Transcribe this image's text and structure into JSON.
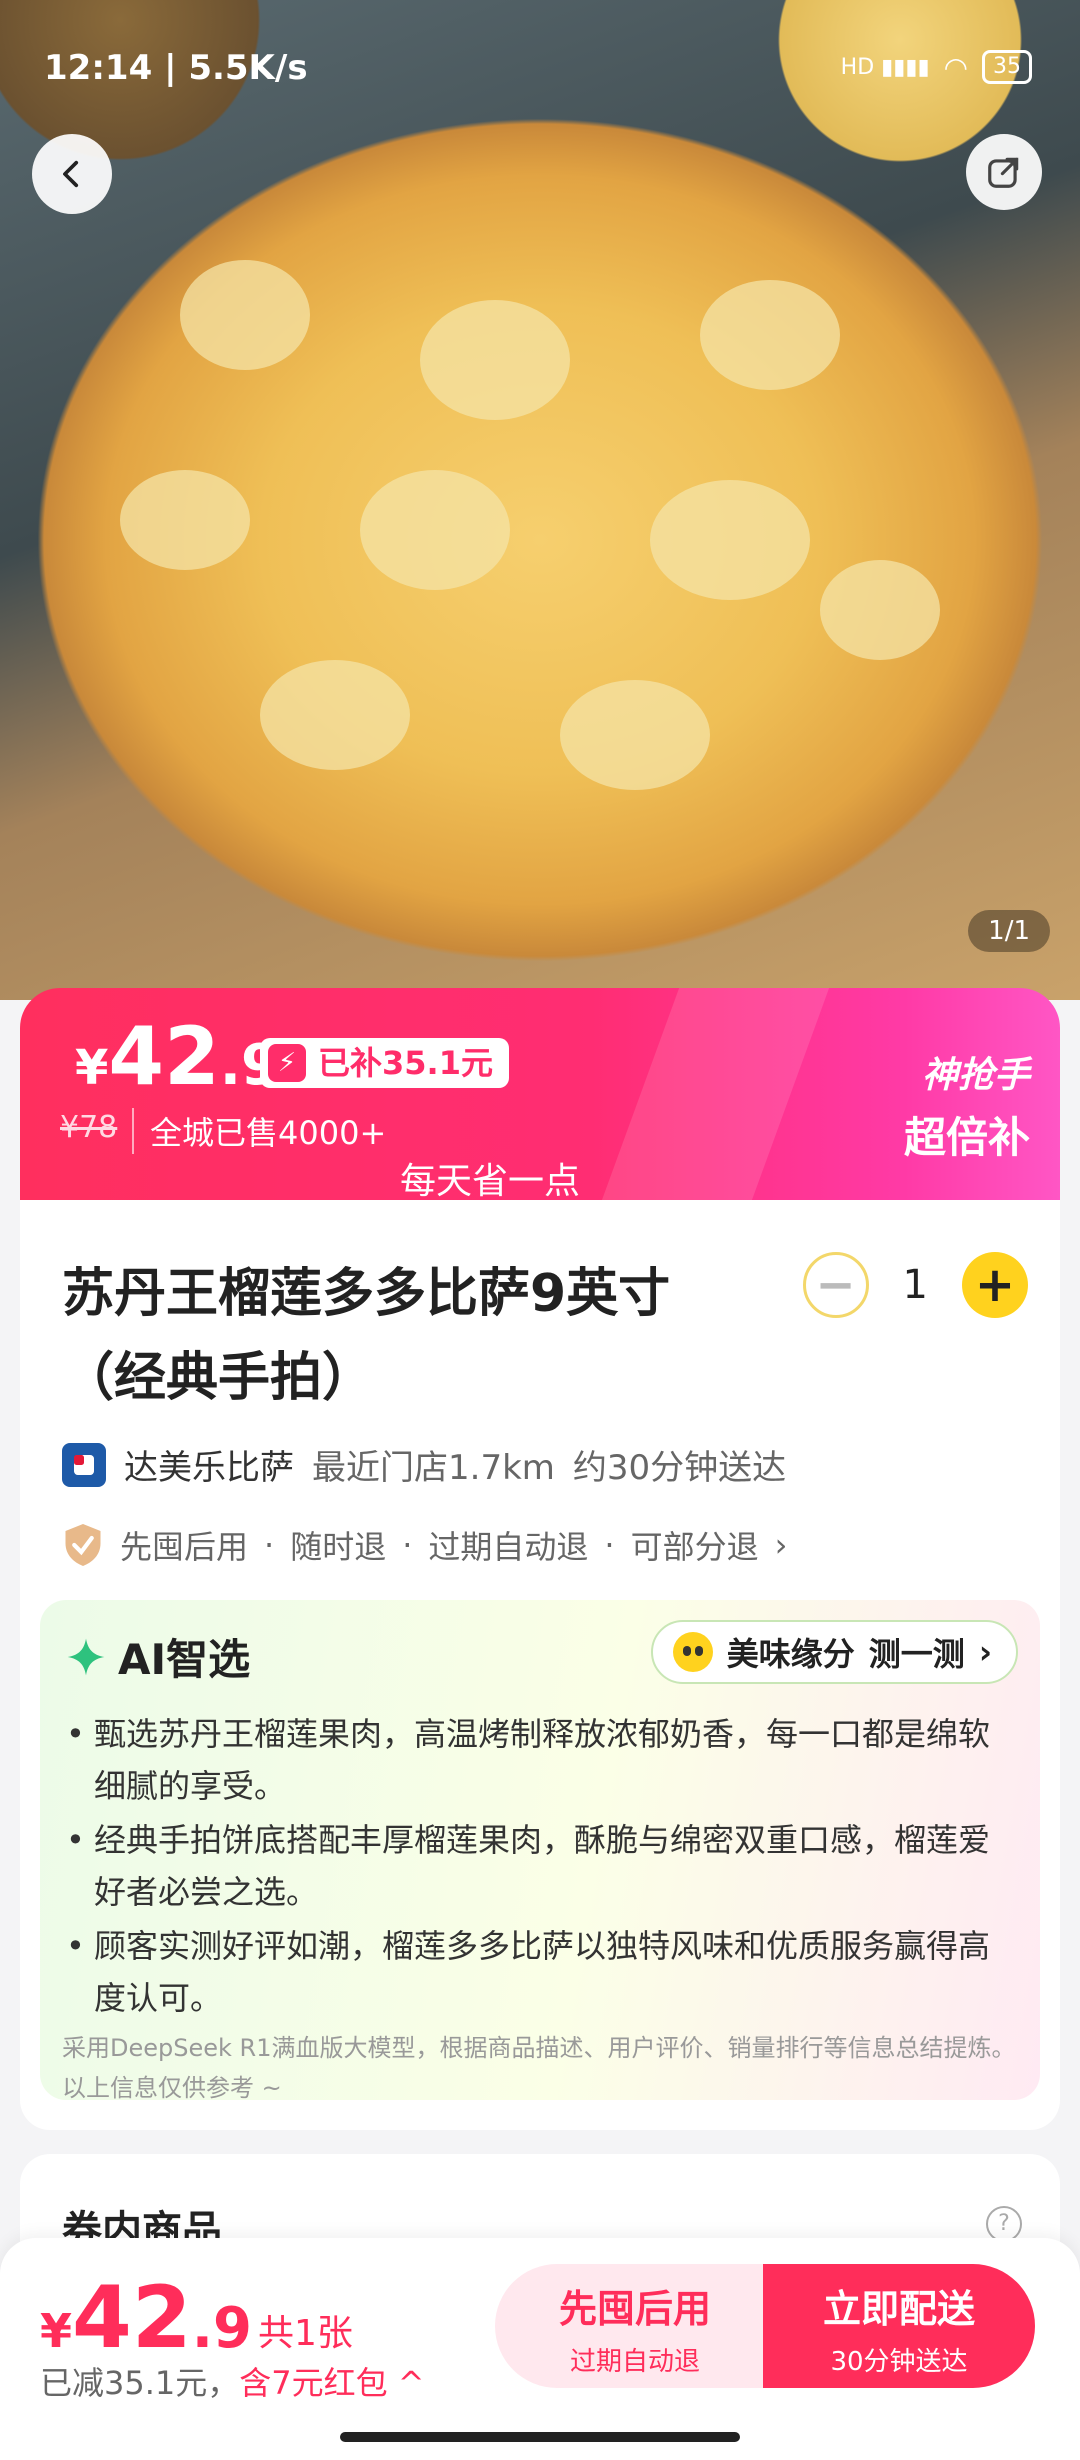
{
  "status_bar": {
    "time": "12:14",
    "speed": "5.5K/s",
    "network": "HD",
    "battery": "35"
  },
  "hero": {
    "image_counter": "1/1"
  },
  "price_banner": {
    "currency": "¥",
    "price_int": "42",
    "price_dec": ".9",
    "subsidy": "已补35.1元",
    "original_price": "¥78",
    "sold": "全城已售4000+",
    "slogan": "每天省一点",
    "brand_line1": "神抢手",
    "brand_line2": "超倍补"
  },
  "product": {
    "title": "苏丹王榴莲多多比萨9英寸（经典手拍）",
    "quantity": "1",
    "minus_symbol": "−",
    "plus_symbol": "+"
  },
  "store": {
    "name": "达美乐比萨",
    "distance": "最近门店1.7km",
    "delivery_time": "约30分钟送达"
  },
  "policies": {
    "items": [
      "先囤后用",
      "随时退",
      "过期自动退",
      "可部分退"
    ],
    "separator": "·",
    "chevron": "›"
  },
  "ai": {
    "title": "AI智选",
    "pill_left": "美味缘分",
    "pill_right": "测一测",
    "bullets": [
      "甄选苏丹王榴莲果肉，高温烤制释放浓郁奶香，每一口都是绵软细腻的享受。",
      "经典手拍饼底搭配丰厚榴莲果肉，酥脆与绵密双重口感，榴莲爱好者必尝之选。",
      "顾客实测好评如潮，榴莲多多比萨以独特风味和优质服务赢得高度认可。"
    ],
    "note": "采用DeepSeek R1满血版大模型，根据商品描述、用户评价、销量排行等信息总结提炼。以上信息仅供参考 ~"
  },
  "section2": {
    "title": "券内商品",
    "help": "?"
  },
  "bottom_bar": {
    "currency": "¥",
    "price_int": "42",
    "price_dec": ".9",
    "count": "共1张",
    "reduced": "已减35.1元，",
    "red_packet": "含7元红包 ^",
    "btn_left_main": "先囤后用",
    "btn_left_sub": "过期自动退",
    "btn_right_main": "立即配送",
    "btn_right_sub": "30分钟送达"
  },
  "colors": {
    "accent": "#ff2d5a",
    "yellow": "#ffd21e",
    "ai_green": "#2ec27e"
  }
}
